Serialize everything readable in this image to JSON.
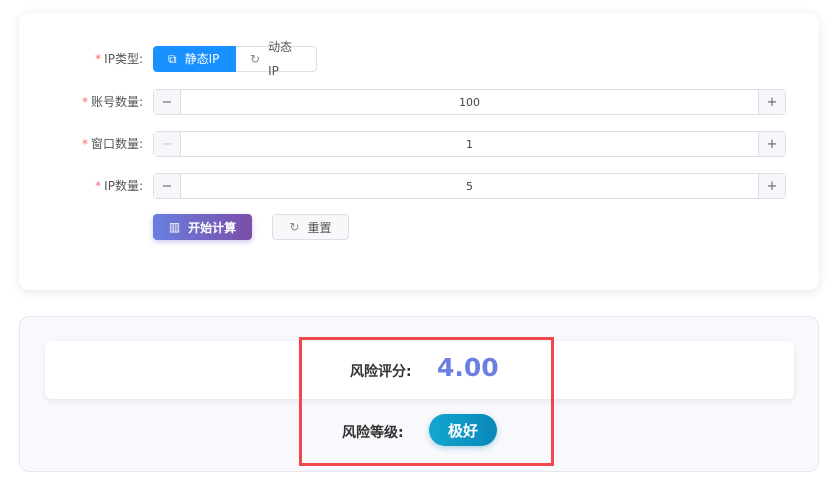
{
  "form": {
    "ip_type": {
      "label": "IP类型:",
      "options": [
        "静态IP",
        "动态IP"
      ],
      "selected": "静态IP"
    },
    "account_count": {
      "label": "账号数量:",
      "value": "100",
      "minus": "−",
      "plus": "+"
    },
    "window_count": {
      "label": "窗口数量:",
      "value": "1",
      "minus": "−",
      "plus": "+"
    },
    "ip_count": {
      "label": "IP数量:",
      "value": "5",
      "minus": "−",
      "plus": "+"
    },
    "required_mark": "*",
    "calculate_label": "开始计算",
    "reset_label": "重置"
  },
  "result": {
    "score_label": "风险评分:",
    "score": "4.00",
    "level_label": "风险等级:",
    "level": "极好"
  },
  "colors": {
    "primary": "#1890ff",
    "score": "#6b7fe0",
    "highlight": "#f0484a"
  }
}
